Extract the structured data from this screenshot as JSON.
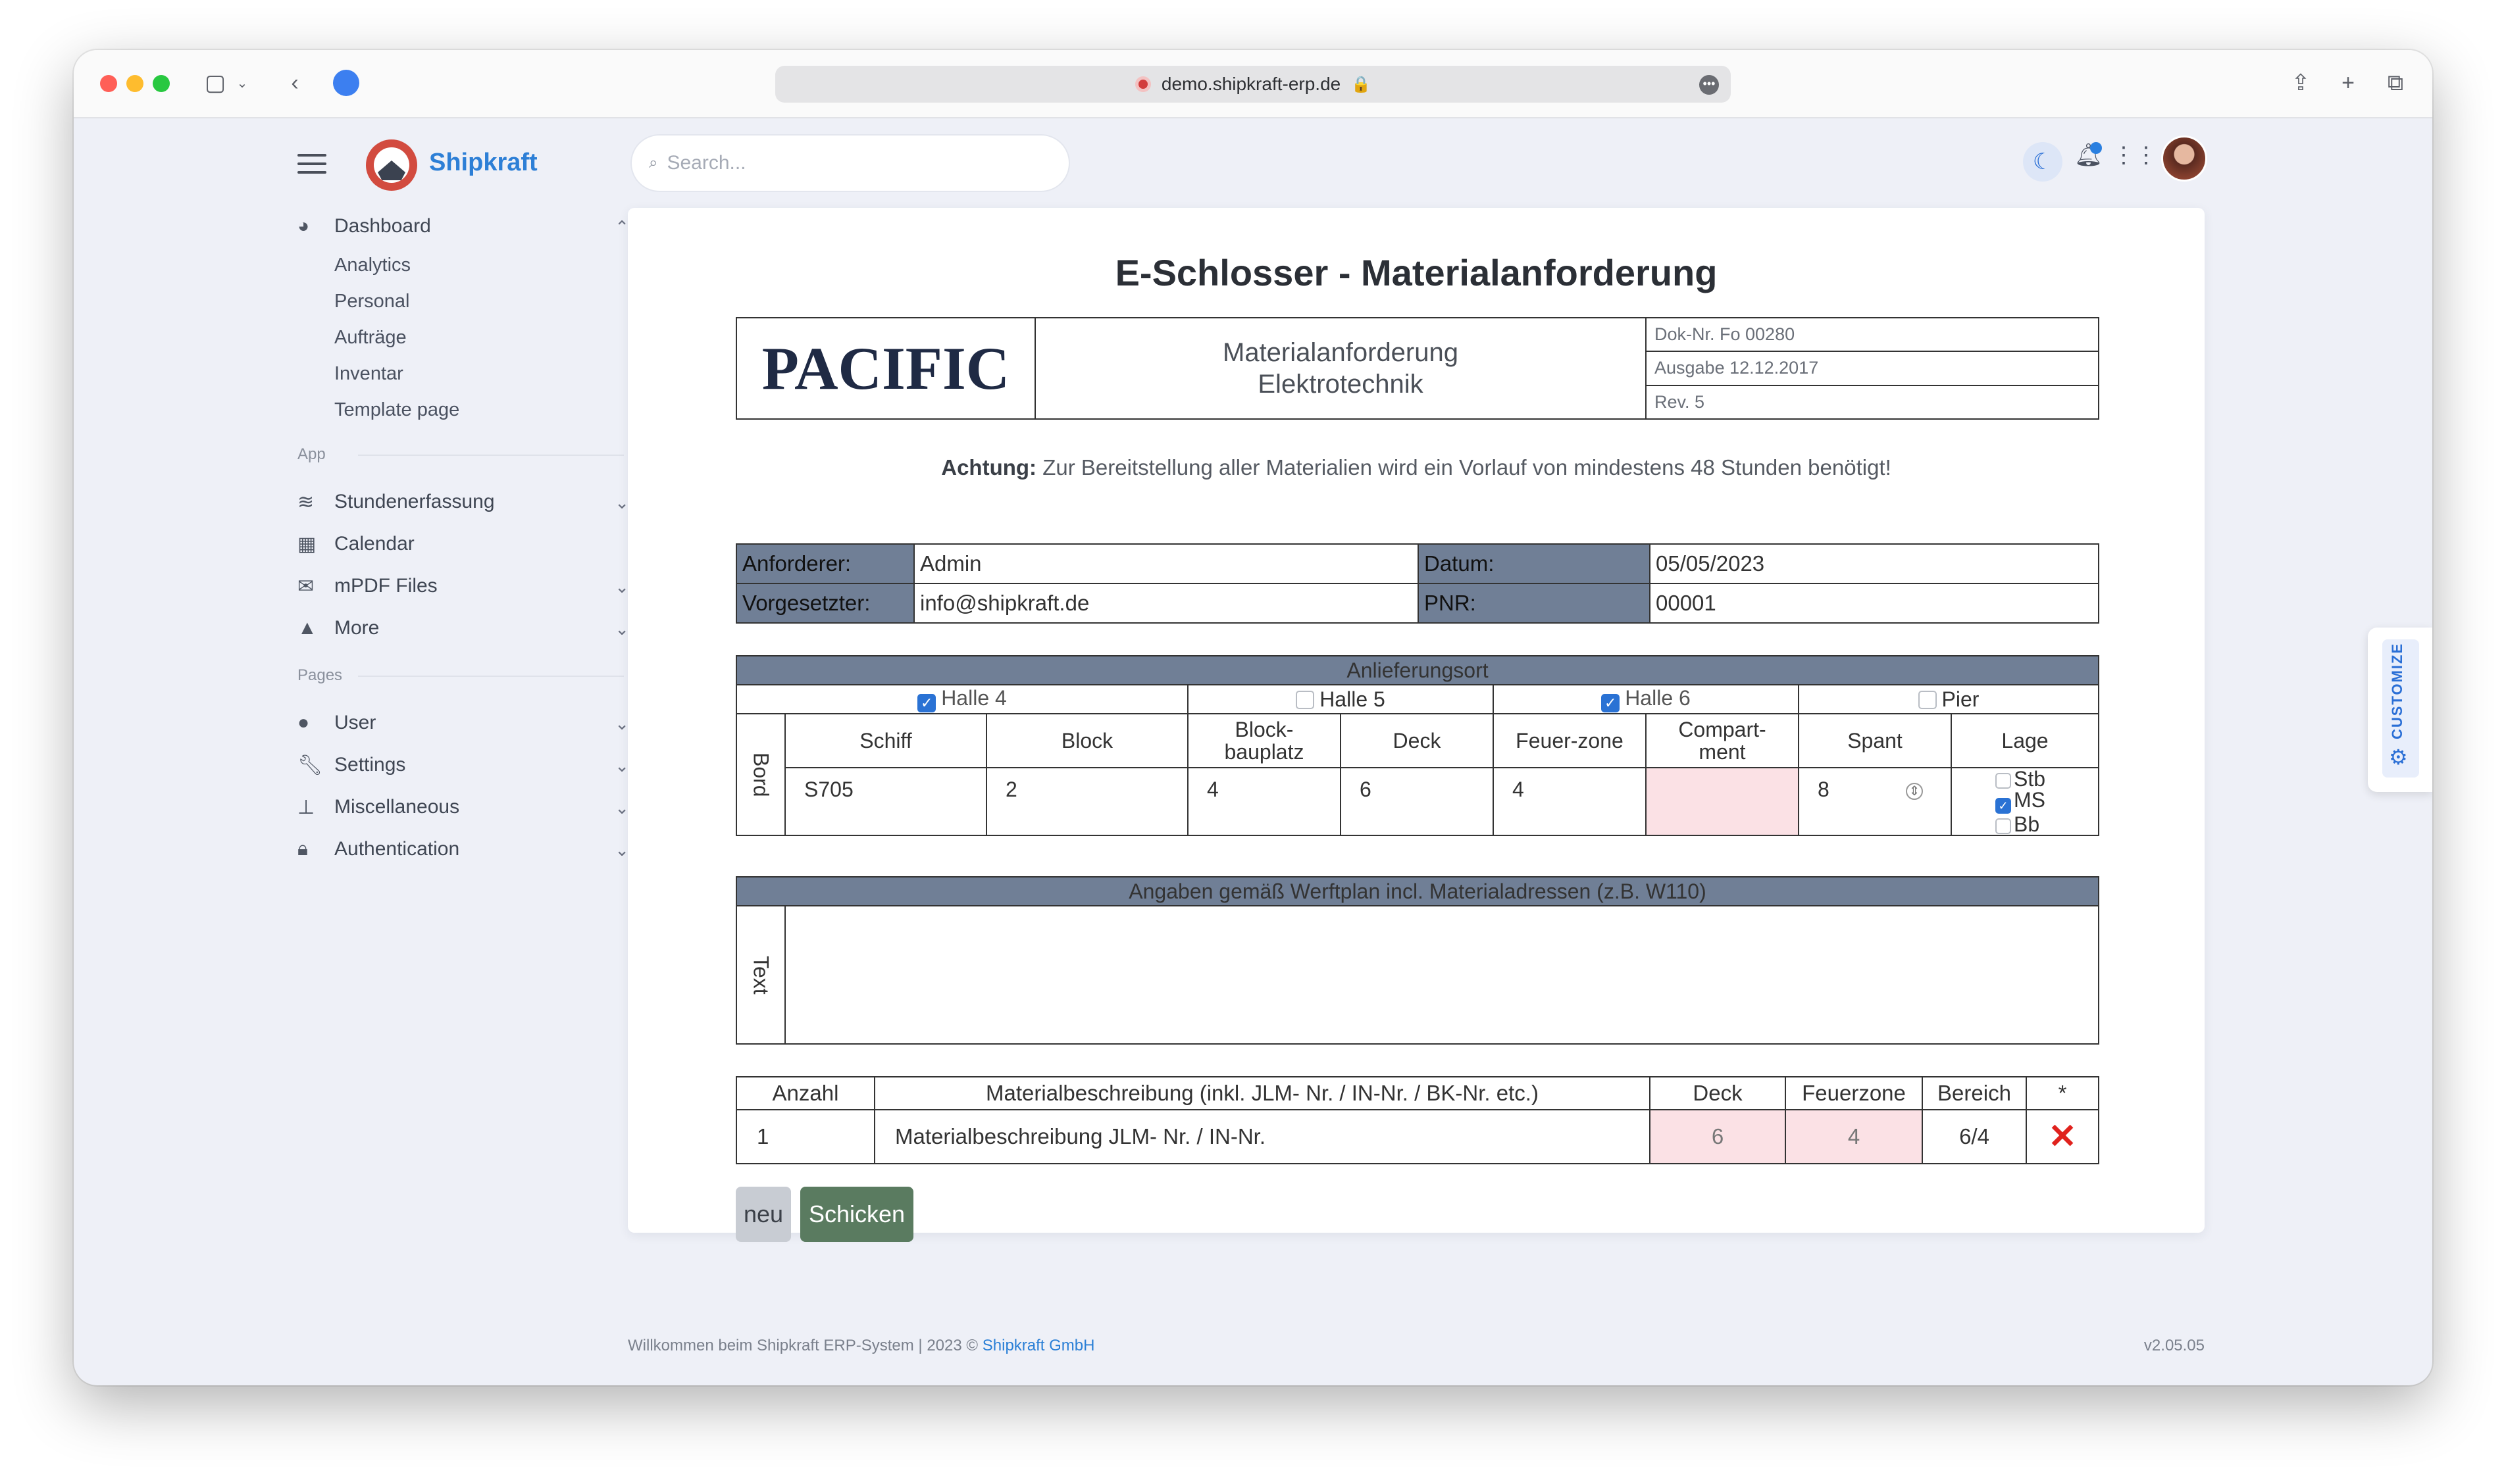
{
  "browser": {
    "url": "demo.shipkraft-erp.de"
  },
  "brand": {
    "name": "Shipkraft"
  },
  "search": {
    "placeholder": "Search..."
  },
  "sidebar": {
    "dashboard": {
      "label": "Dashboard",
      "children": [
        "Analytics",
        "Personal",
        "Aufträge",
        "Inventar",
        "Template page"
      ]
    },
    "section_app": "App",
    "app_items": [
      "Stundenerfassung",
      "Calendar",
      "mPDF Files",
      "More"
    ],
    "section_pages": "Pages",
    "page_items": [
      "User",
      "Settings",
      "Miscellaneous",
      "Authentication"
    ]
  },
  "page": {
    "title": "E-Schlosser - Materialanforderung",
    "logo_text": "PACIFIC",
    "form_title_line1": "Materialanforderung",
    "form_title_line2": "Elektrotechnik",
    "doc_no": "Dok-Nr. Fo 00280",
    "edition": "Ausgabe 12.12.2017",
    "rev": "Rev. 5",
    "warning_label": "Achtung:",
    "warning_text": " Zur Bereitstellung aller Materialien wird ein Vorlauf von mindestens 48 Stunden benötigt!"
  },
  "request": {
    "requester_label": "Anforderer:",
    "requester_value": "Admin",
    "date_label": "Datum:",
    "date_value": "05/05/2023",
    "supervisor_label": "Vorgesetzter:",
    "supervisor_value": "info@shipkraft.de",
    "pnr_label": "PNR:",
    "pnr_value": "00001"
  },
  "delivery": {
    "header": "Anlieferungsort",
    "halls": [
      {
        "label": "Halle 4",
        "checked": true
      },
      {
        "label": "Halle 5",
        "checked": false
      },
      {
        "label": "Halle 6",
        "checked": true
      },
      {
        "label": "Pier",
        "checked": false
      }
    ],
    "side_label": "Bord",
    "columns": [
      "Schiff",
      "Block",
      "Block-bauplatz",
      "Deck",
      "Feuer-zone",
      "Compart-ment",
      "Spant",
      "Lage"
    ],
    "column_line_breaks": {
      "Block-bauplatz": [
        "Block-",
        "bauplatz"
      ],
      "Compart-ment": [
        "Compart-",
        "ment"
      ]
    },
    "values": {
      "schiff": "S705",
      "block": "2",
      "blockbauplatz": "4",
      "deck": "6",
      "feuerzone": "4",
      "compartment": "",
      "spant": "8"
    },
    "lage_options": [
      {
        "label": "Stb",
        "checked": false
      },
      {
        "label": "MS",
        "checked": true
      },
      {
        "label": "Bb",
        "checked": false
      }
    ]
  },
  "notes": {
    "header": "Angaben gemäß Werftplan incl. Materialadressen (z.B. W110)",
    "side_label": "Text",
    "value": ""
  },
  "materials": {
    "columns": [
      "Anzahl",
      "Materialbeschreibung (inkl. JLM- Nr. / IN-Nr. / BK-Nr. etc.)",
      "Deck",
      "Feuerzone",
      "Bereich",
      "*"
    ],
    "rows": [
      {
        "anzahl": "1",
        "beschreibung": "Materialbeschreibung  JLM- Nr. / IN-Nr.",
        "deck": "6",
        "feuerzone": "4",
        "bereich": "6/4"
      }
    ]
  },
  "buttons": {
    "new": "neu",
    "send": "Schicken"
  },
  "customize_label": "CUSTOMIZE",
  "footer": {
    "text": "Willkommen beim Shipkraft ERP-System | 2023 © ",
    "link": "Shipkraft GmbH",
    "version": "v2.05.05"
  },
  "colors": {
    "accent": "#2d7fd6",
    "table_header": "#707f96",
    "send_button": "#5a7b60",
    "required_field": "#fbe1e5"
  }
}
